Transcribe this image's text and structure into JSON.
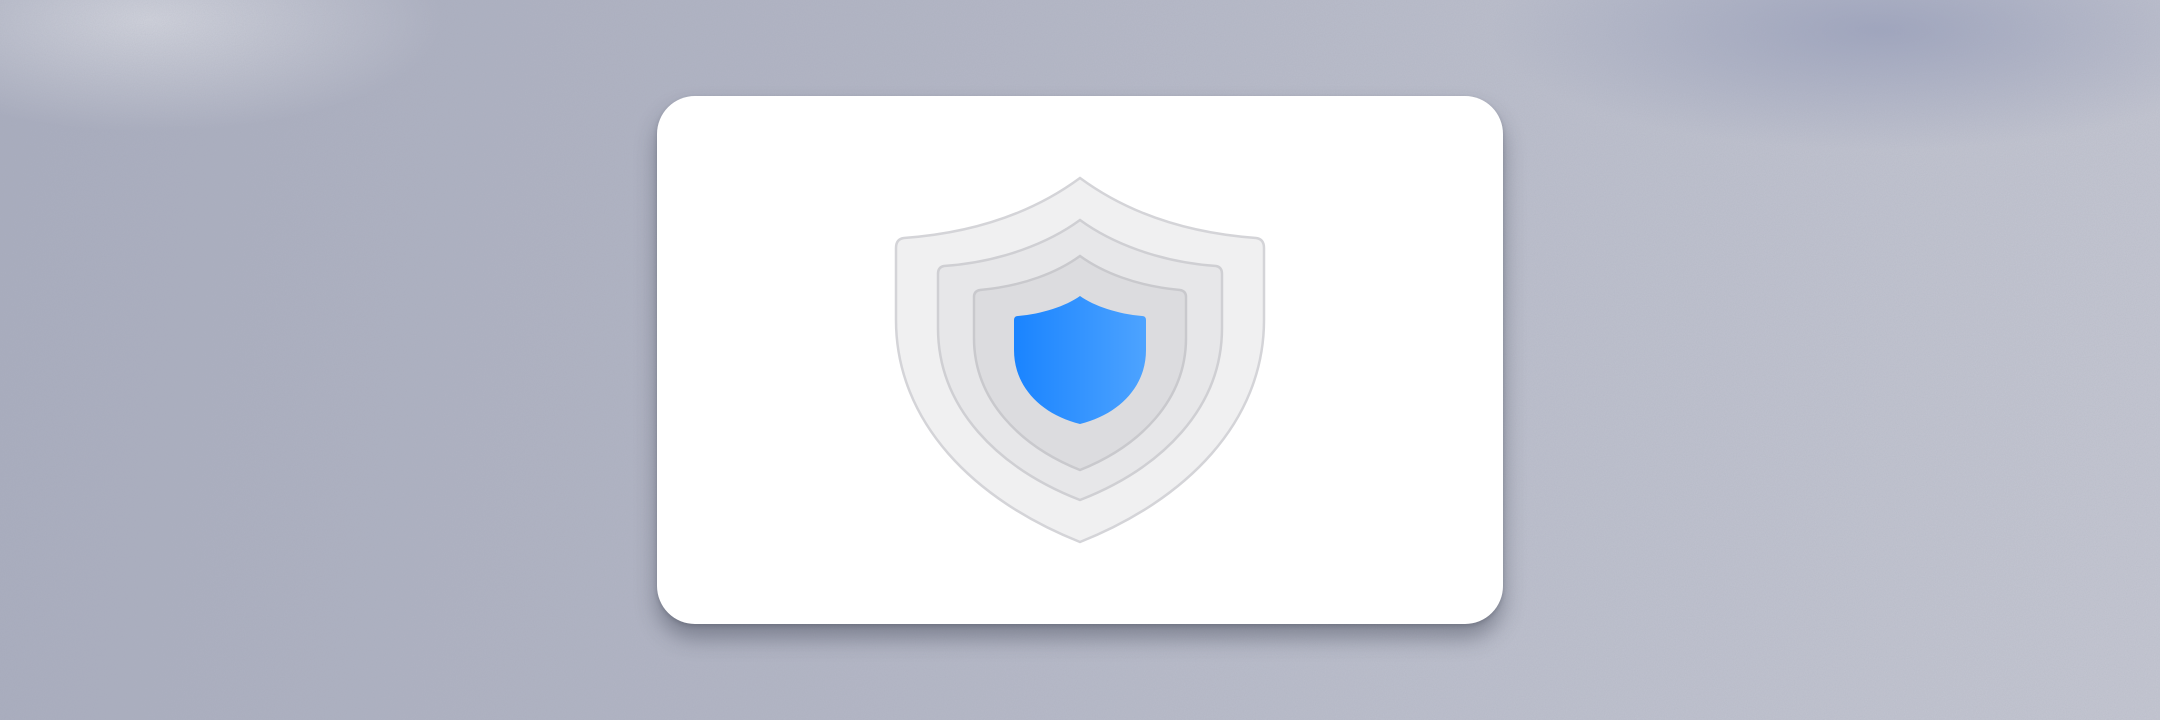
{
  "colors": {
    "accent_blue": "#1a84ff",
    "accent_blue_light": "#4da3ff",
    "outer_ring_fill": "#f0f0f1",
    "middle_ring_fill": "#e7e7e9",
    "inner_ring_fill": "#dcdcdf",
    "ring_stroke": "#cfcfd3",
    "card_background": "#ffffff"
  },
  "icons": {
    "hero": "security-shield-icon"
  }
}
